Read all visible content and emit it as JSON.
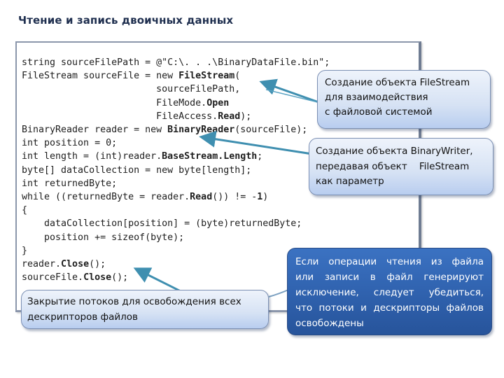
{
  "slide": {
    "title": "Чтение и запись двоичных данных"
  },
  "code": {
    "lines": [
      [
        {
          "t": "string sourceFilePath = @\"C:\\. . .\\BinaryDataFile.bin\";"
        }
      ],
      [
        {
          "t": "FileStream sourceFile = new "
        },
        {
          "t": "FileStream",
          "b": true
        },
        {
          "t": "("
        }
      ],
      [
        {
          "t": "                        sourceFilePath,"
        }
      ],
      [
        {
          "t": "                        FileMode."
        },
        {
          "t": "Open",
          "b": true
        }
      ],
      [
        {
          "t": "                        FileAccess."
        },
        {
          "t": "Read",
          "b": true
        },
        {
          "t": ");"
        }
      ],
      [
        {
          "t": "BinaryReader reader = new "
        },
        {
          "t": "BinaryReader",
          "b": true
        },
        {
          "t": "(sourceFile);"
        }
      ],
      [
        {
          "t": "int position = 0;"
        }
      ],
      [
        {
          "t": "int length = (int)reader."
        },
        {
          "t": "BaseStream.Length",
          "b": true
        },
        {
          "t": ";"
        }
      ],
      [
        {
          "t": "byte[] dataCollection = new byte[length];"
        }
      ],
      [
        {
          "t": "int returnedByte;"
        }
      ],
      [
        {
          "t": "while ((returnedByte = reader."
        },
        {
          "t": "Read",
          "b": true
        },
        {
          "t": "()) != -"
        },
        {
          "t": "1",
          "b": true
        },
        {
          "t": ")"
        }
      ],
      [
        {
          "t": "{"
        }
      ],
      [
        {
          "t": "    dataCollection[position] = (byte)returnedByte;"
        }
      ],
      [
        {
          "t": "    position += sizeof(byte);"
        }
      ],
      [
        {
          "t": "}"
        }
      ],
      [
        {
          "t": "reader."
        },
        {
          "t": "Close",
          "b": true
        },
        {
          "t": "();"
        }
      ],
      [
        {
          "t": "sourceFile."
        },
        {
          "t": "Close",
          "b": true
        },
        {
          "t": "();"
        }
      ]
    ]
  },
  "callouts": {
    "filestream": {
      "lines": [
        "Создание объекта FileStream",
        "для взаимодействия",
        "с файловой системой"
      ]
    },
    "binarywriter": {
      "lines": [
        "Создание объекта BinaryWriter,",
        "передавая объект    FileStream",
        "как параметр"
      ]
    },
    "close_streams": {
      "lines": [
        "Закрытие потоков для освобождения всех",
        "дескрипторов файлов"
      ]
    },
    "exceptions": {
      "lines": [
        "Если операции чтения из файла",
        "или записи в файл генерируют",
        "исключение, следует убедиться,",
        "что потоки и дескрипторы файлов",
        "освобождены"
      ]
    }
  },
  "colors": {
    "title": "#1f2f4f",
    "arrow": "#3f8fb0",
    "callout_dark": "#2f61ad",
    "callout_light": "#d6e2f4"
  }
}
